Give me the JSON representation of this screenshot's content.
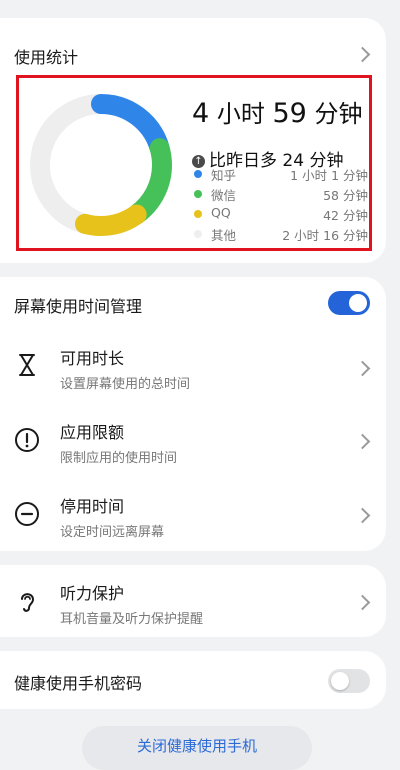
{
  "usage_stats": {
    "title": "使用统计",
    "total_hours_num": "4",
    "total_hours_unit": "小时",
    "total_minutes_num": "59",
    "total_minutes_unit": "分钟",
    "delta_text": "比昨日多 24 分钟",
    "legend": [
      {
        "name": "知乎",
        "time": "1 小时 1 分钟",
        "color": "#2f86e8"
      },
      {
        "name": "微信",
        "time": "58 分钟",
        "color": "#46c15a"
      },
      {
        "name": "QQ",
        "time": "42 分钟",
        "color": "#e6c21a"
      },
      {
        "name": "其他",
        "time": "2 小时 16 分钟",
        "color": "#eeeeee"
      }
    ],
    "chart_data": {
      "type": "pie",
      "categories": [
        "知乎",
        "微信",
        "QQ",
        "其他"
      ],
      "values": [
        61,
        58,
        42,
        136
      ],
      "unit": "分钟"
    }
  },
  "screen_time": {
    "title": "屏幕使用时间管理",
    "toggle_on": true,
    "items": [
      {
        "title": "可用时长",
        "subtitle": "设置屏幕使用的总时间",
        "icon": "hourglass-icon"
      },
      {
        "title": "应用限额",
        "subtitle": "限制应用的使用时间",
        "icon": "alert-circle-icon"
      },
      {
        "title": "停用时间",
        "subtitle": "设定时间远离屏幕",
        "icon": "minus-circle-icon"
      }
    ]
  },
  "hearing": {
    "title": "听力保护",
    "subtitle": "耳机音量及听力保护提醒",
    "icon": "ear-icon"
  },
  "password": {
    "title": "健康使用手机密码",
    "toggle_on": false
  },
  "bottom_button": {
    "label": "关闭健康使用手机"
  },
  "colors": {
    "accent": "#2463d8",
    "toggle_off": "#e2e3e5"
  }
}
